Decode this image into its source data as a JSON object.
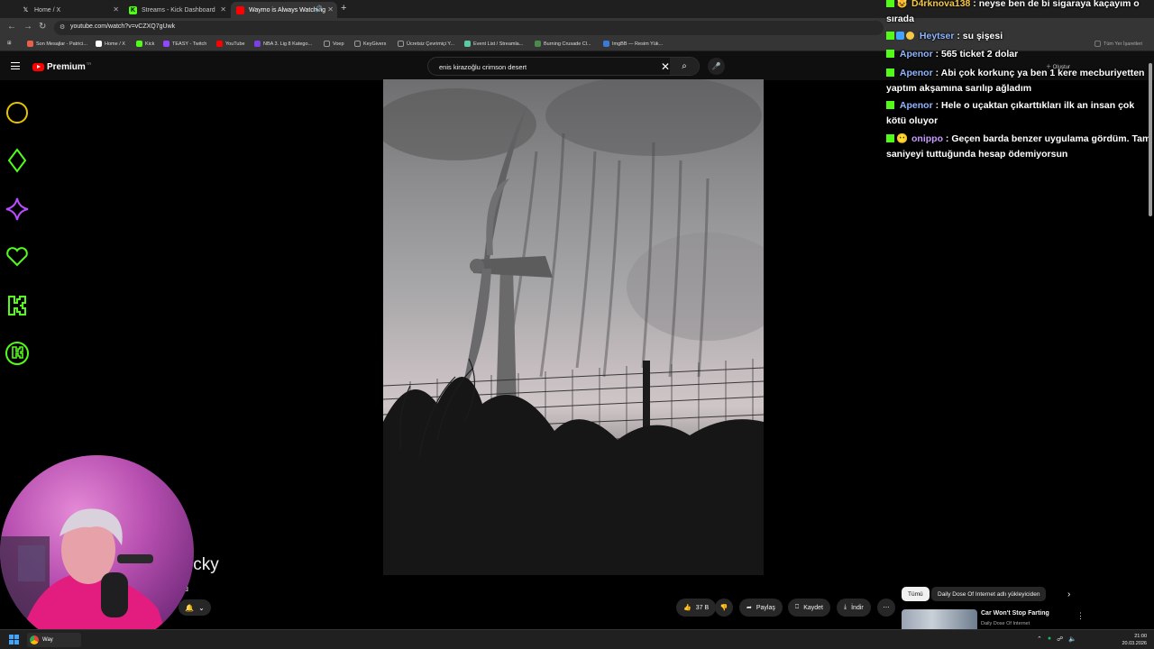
{
  "browser": {
    "tabs": [
      {
        "label": "Home / X",
        "icon": "x-logo-icon",
        "active": false
      },
      {
        "label": "Streams - Kick Dashboard",
        "icon": "kick-logo-icon",
        "active": false
      },
      {
        "label": "Waymo is Always Watching",
        "icon": "youtube-logo-icon",
        "active": true
      }
    ],
    "url": "youtube.com/watch?v=vCZXQ7gUwk",
    "bookmarks": [
      {
        "label": "Son Mesajlar - Patrici...",
        "color": "#e8604c"
      },
      {
        "label": "Home / X",
        "color": "#ffffff"
      },
      {
        "label": "Kick",
        "color": "#53fc18"
      },
      {
        "label": "TEASY - Twitch",
        "color": "#9146ff"
      },
      {
        "label": "YouTube",
        "color": "#ff0000"
      },
      {
        "label": "NBA 3. Lig 8 Katego...",
        "color": "#7b3fe4"
      },
      {
        "label": "Voep",
        "color": "#777777"
      },
      {
        "label": "KeyGivers",
        "color": "#777777"
      },
      {
        "label": "Ücretsiz Çevrimiçi Y...",
        "color": "#777777"
      },
      {
        "label": "Event List / Streamla...",
        "color": "#5dc8a6"
      },
      {
        "label": "Burning Crusade Cl...",
        "color": "#4c8a4c"
      },
      {
        "label": "ImgBB — Resim Yük...",
        "color": "#3c7ad6"
      },
      {
        "label": "Tüm Yer İşaretleri",
        "color": "#777777"
      }
    ]
  },
  "youtube": {
    "brand": "Premium",
    "brand_region": "TR",
    "search_query": "enis kirazoğlu crimson desert",
    "create_label": "Oluştur",
    "video_title_partial": "icky",
    "channel_partial": "u",
    "actions": {
      "likes": "37 B",
      "share": "Paylaş",
      "save": "Kaydet",
      "download": "İndir"
    },
    "filters": [
      "Tümü",
      "Daily Dose Of Internet adlı yükleyiciden"
    ],
    "recommendation": {
      "title": "Car Won't Stop Farting",
      "channel": "Daily Dose Of Internet"
    }
  },
  "chat": {
    "messages": [
      {
        "user": "D4rknova138",
        "text": ": neyse ben de bi sigaraya kaçayım o sırada",
        "user_color": "#f6c945"
      },
      {
        "user": "Heytser",
        "text": ": su şişesi",
        "user_color": "#8fb6ff"
      },
      {
        "user": "Apenor",
        "text": ": 565 ticket 2 dolar",
        "user_color": "#8fb6ff"
      },
      {
        "user": "Apenor",
        "text": ": Abi çok korkunç ya ben 1 kere mecburiyetten yaptım akşamına sarılıp ağladım",
        "user_color": "#8fb6ff"
      },
      {
        "user": "Apenor",
        "text": ": Hele o uçaktan çıkarttıkları ilk an insan çok kötü oluyor",
        "user_color": "#8fb6ff"
      },
      {
        "user": "onippo",
        "text": ": Geçen barda benzer uygulama gördüm. Tam saniyeyi tuttuğunda hesap ödemiyorsun",
        "user_color": "#c89bff"
      }
    ]
  },
  "taskbar": {
    "app_label": "Way",
    "time": "21:00",
    "date": "20.03.2026"
  },
  "colors": {
    "overlay_gold": "#e8c400",
    "overlay_green": "#53fc18",
    "overlay_purple": "#b84cff"
  }
}
